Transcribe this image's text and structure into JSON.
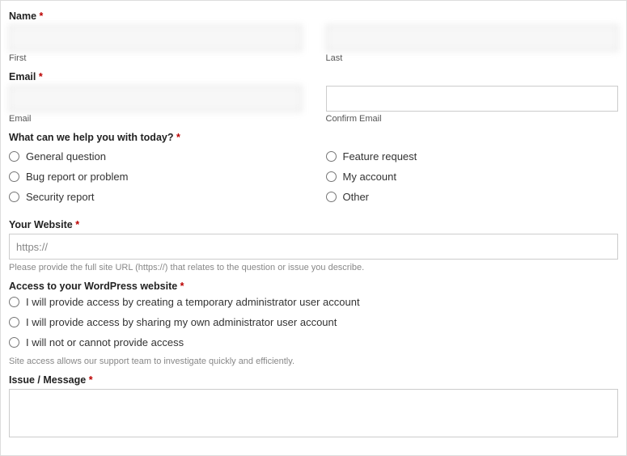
{
  "name": {
    "label": "Name",
    "first_sub": "First",
    "last_sub": "Last",
    "first_value": "",
    "last_value": ""
  },
  "email": {
    "label": "Email",
    "email_sub": "Email",
    "confirm_sub": "Confirm Email",
    "email_value": "",
    "confirm_value": ""
  },
  "help": {
    "label": "What can we help you with today?",
    "options_left": [
      "General question",
      "Bug report or problem",
      "Security report"
    ],
    "options_right": [
      "Feature request",
      "My account",
      "Other"
    ]
  },
  "website": {
    "label": "Your Website",
    "value": "https://",
    "help": "Please provide the full site URL (https://) that relates to the question or issue you describe."
  },
  "access": {
    "label": "Access to your WordPress website",
    "options": [
      "I will provide access by creating a temporary administrator user account",
      "I will provide access by sharing my own administrator user account",
      "I will not or cannot provide access"
    ],
    "help": "Site access allows our support team to investigate quickly and efficiently."
  },
  "issue": {
    "label": "Issue / Message"
  }
}
